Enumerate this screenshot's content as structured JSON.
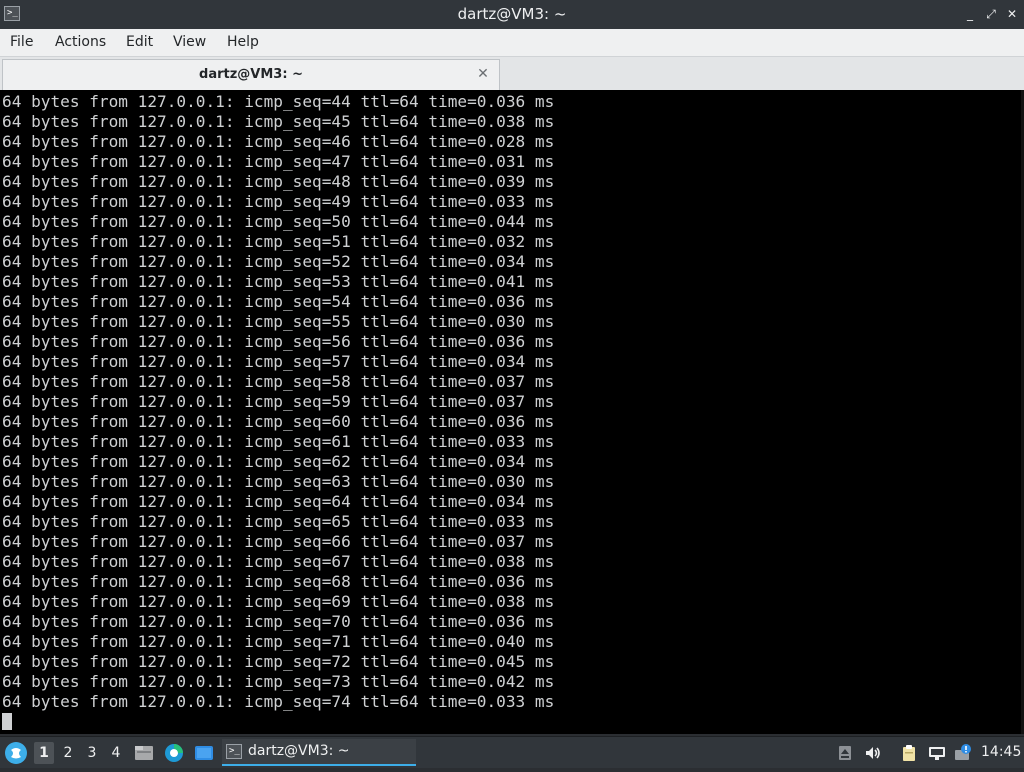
{
  "window": {
    "title": "dartz@VM3: ~",
    "controls": {
      "minimize": "_",
      "maximize": "⤢",
      "close": "✕"
    }
  },
  "menu": {
    "items": [
      "File",
      "Actions",
      "Edit",
      "View",
      "Help"
    ]
  },
  "tab": {
    "label": "dartz@VM3: ~",
    "close_glyph": "✕"
  },
  "terminal": {
    "lines": [
      "64 bytes from 127.0.0.1: icmp_seq=44 ttl=64 time=0.036 ms",
      "64 bytes from 127.0.0.1: icmp_seq=45 ttl=64 time=0.038 ms",
      "64 bytes from 127.0.0.1: icmp_seq=46 ttl=64 time=0.028 ms",
      "64 bytes from 127.0.0.1: icmp_seq=47 ttl=64 time=0.031 ms",
      "64 bytes from 127.0.0.1: icmp_seq=48 ttl=64 time=0.039 ms",
      "64 bytes from 127.0.0.1: icmp_seq=49 ttl=64 time=0.033 ms",
      "64 bytes from 127.0.0.1: icmp_seq=50 ttl=64 time=0.044 ms",
      "64 bytes from 127.0.0.1: icmp_seq=51 ttl=64 time=0.032 ms",
      "64 bytes from 127.0.0.1: icmp_seq=52 ttl=64 time=0.034 ms",
      "64 bytes from 127.0.0.1: icmp_seq=53 ttl=64 time=0.041 ms",
      "64 bytes from 127.0.0.1: icmp_seq=54 ttl=64 time=0.036 ms",
      "64 bytes from 127.0.0.1: icmp_seq=55 ttl=64 time=0.030 ms",
      "64 bytes from 127.0.0.1: icmp_seq=56 ttl=64 time=0.036 ms",
      "64 bytes from 127.0.0.1: icmp_seq=57 ttl=64 time=0.034 ms",
      "64 bytes from 127.0.0.1: icmp_seq=58 ttl=64 time=0.037 ms",
      "64 bytes from 127.0.0.1: icmp_seq=59 ttl=64 time=0.037 ms",
      "64 bytes from 127.0.0.1: icmp_seq=60 ttl=64 time=0.036 ms",
      "64 bytes from 127.0.0.1: icmp_seq=61 ttl=64 time=0.033 ms",
      "64 bytes from 127.0.0.1: icmp_seq=62 ttl=64 time=0.034 ms",
      "64 bytes from 127.0.0.1: icmp_seq=63 ttl=64 time=0.030 ms",
      "64 bytes from 127.0.0.1: icmp_seq=64 ttl=64 time=0.034 ms",
      "64 bytes from 127.0.0.1: icmp_seq=65 ttl=64 time=0.033 ms",
      "64 bytes from 127.0.0.1: icmp_seq=66 ttl=64 time=0.037 ms",
      "64 bytes from 127.0.0.1: icmp_seq=67 ttl=64 time=0.038 ms",
      "64 bytes from 127.0.0.1: icmp_seq=68 ttl=64 time=0.036 ms",
      "64 bytes from 127.0.0.1: icmp_seq=69 ttl=64 time=0.038 ms",
      "64 bytes from 127.0.0.1: icmp_seq=70 ttl=64 time=0.036 ms",
      "64 bytes from 127.0.0.1: icmp_seq=71 ttl=64 time=0.040 ms",
      "64 bytes from 127.0.0.1: icmp_seq=72 ttl=64 time=0.045 ms",
      "64 bytes from 127.0.0.1: icmp_seq=73 ttl=64 time=0.042 ms",
      "64 bytes from 127.0.0.1: icmp_seq=74 ttl=64 time=0.033 ms"
    ]
  },
  "taskbar": {
    "launcher_icon": "app-launcher-icon",
    "workspaces": [
      "1",
      "2",
      "3",
      "4"
    ],
    "active_workspace": "1",
    "quicklaunch": [
      "file-manager-icon",
      "browser-icon",
      "desktop-icon"
    ],
    "task_label": "dartz@VM3: ~",
    "tray": [
      "removable-media-icon",
      "volume-icon",
      "clipboard-icon",
      "network-icon",
      "update-notifier-icon"
    ],
    "clock": "14:45"
  },
  "colors": {
    "titlebar": "#31363b",
    "terminal_bg": "#000000",
    "terminal_fg": "#cfd1d3",
    "accent": "#3daee9"
  }
}
